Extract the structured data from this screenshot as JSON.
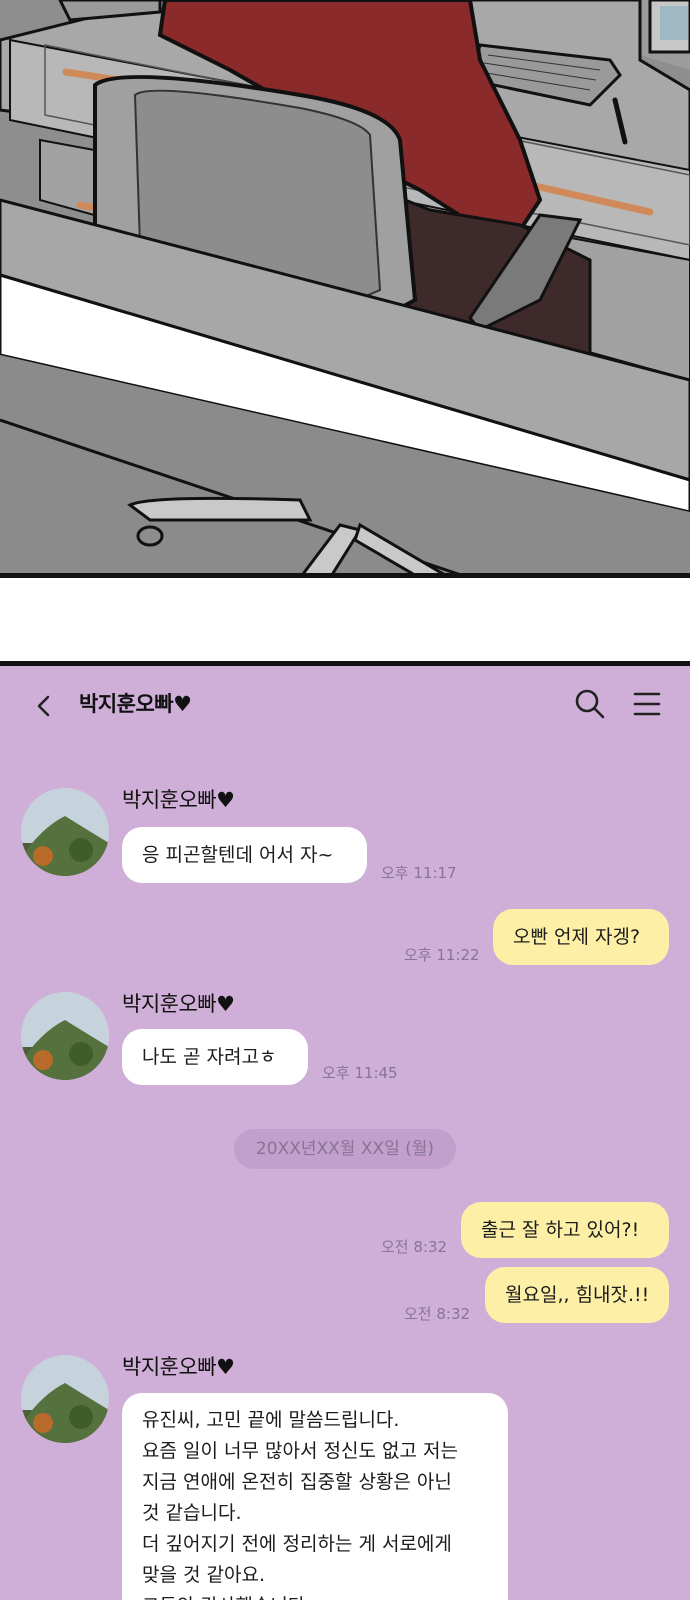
{
  "chat": {
    "contact_name": "박지훈오빠♥",
    "date_divider": "20XX년XX월 XX일 (월)",
    "messages": [
      {
        "sender": "박지훈오빠♥",
        "text": "응 피곤할텐데 어서 자~",
        "time": "오후 11:17"
      },
      {
        "sender": "me",
        "text": "오빤 언제 자겡?",
        "time": "오후 11:22"
      },
      {
        "sender": "박지훈오빠♥",
        "text": "나도 곧 자려고ㅎ",
        "time": "오후 11:45"
      },
      {
        "sender": "me",
        "text": "출근 잘 하고 있어?!",
        "time": "오전 8:32"
      },
      {
        "sender": "me",
        "text": "월요일,, 힘내잣.!!",
        "time": "오전 8:32"
      },
      {
        "sender": "박지훈오빠♥",
        "lines": [
          "유진씨, 고민 끝에 말씀드립니다.",
          "요즘 일이 너무 많아서 정신도 없고 저는",
          "지금 연애에 온전히 집중할 상황은 아닌",
          "것 같습니다.",
          "더 깊어지기 전에 정리하는 게 서로에게",
          "맞을 것 같아요.",
          "그동안 감사했습니다."
        ]
      }
    ]
  },
  "icons": {
    "back": "chevron-left-icon",
    "search": "search-icon",
    "menu": "menu-icon"
  },
  "colors": {
    "chat_background": "#cfafd8",
    "outgoing_bubble": "#fdf0a6",
    "incoming_bubble": "#ffffff",
    "comic_floor": "#9a9a9a",
    "jacket": "#8b2a2a"
  }
}
